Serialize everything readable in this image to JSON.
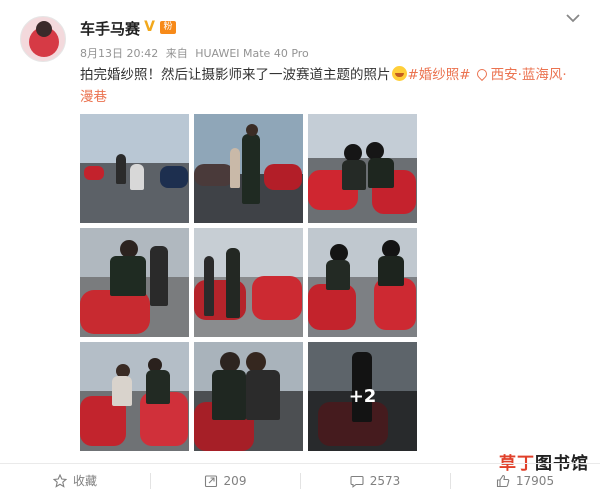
{
  "post": {
    "username": "车手马赛",
    "verified_badge": "V",
    "fan_badge": "粉",
    "meta": {
      "date": "8月13日 20:42",
      "source_prefix": "来自",
      "device": "HUAWEI Mate 40 Pro"
    },
    "text": {
      "main": "拍完婚纱照！然后让摄影师来了一波赛道主题的照片",
      "topic": "#婚纱照#",
      "location": "西安·蓝海风·漫巷"
    },
    "photos": {
      "count_shown": 9,
      "more_label": "+2"
    }
  },
  "footer": {
    "favorite_label": "收藏",
    "repost_count": "209",
    "comment_count": "2573",
    "like_count": "17905"
  },
  "watermark": {
    "part1": "草丁",
    "part2": "图书馆"
  },
  "colors": {
    "accent": "#eb7350",
    "text": "#333333",
    "meta": "#939393",
    "verified": "#f2a81c"
  },
  "icons": [
    "chevron-down-icon",
    "location-icon",
    "emoji-icon",
    "star-icon",
    "repost-icon",
    "comment-icon",
    "like-icon"
  ]
}
